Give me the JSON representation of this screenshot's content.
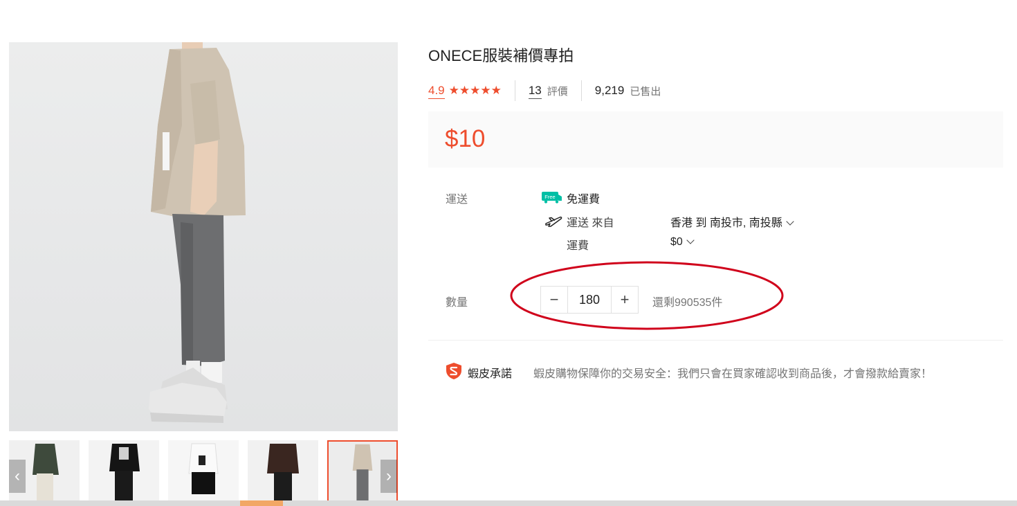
{
  "product": {
    "title": "ONECE服裝補價專拍",
    "rating": "4.9",
    "stars": "★★★★★",
    "review_count": "13",
    "review_label": "評價",
    "sold_count": "9,219",
    "sold_label": "已售出",
    "price": "$10"
  },
  "shipping": {
    "label": "運送",
    "free_badge": "Free",
    "free_text": "免運費",
    "from_label": "運送 來自",
    "route": "香港 到 南投市, 南投縣",
    "fee_label": "運費",
    "fee_value": "$0"
  },
  "quantity": {
    "label": "數量",
    "minus": "−",
    "value": "180",
    "plus": "+",
    "stock": "還剩990535件"
  },
  "promise": {
    "label": "蝦皮承諾",
    "text": "蝦皮購物保障你的交易安全：我們只會在買家確認收到商品後，才會撥款給賣家！"
  },
  "gallery": {
    "prev": "‹",
    "next": "›",
    "thumb_count": 5,
    "active_index": 4
  },
  "colors": {
    "accent": "#ee4d2d",
    "highlight_ring": "#d0021b"
  }
}
